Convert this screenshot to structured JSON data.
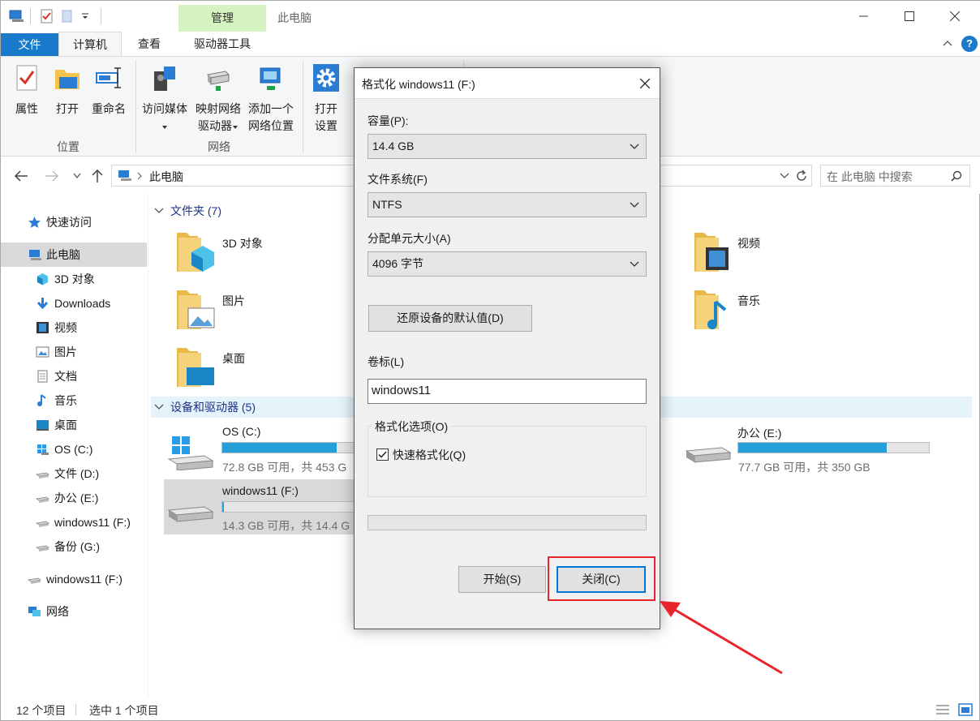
{
  "title_bar": {
    "context_tab": "管理",
    "window_title": "此电脑"
  },
  "tabs": {
    "file": "文件",
    "computer": "计算机",
    "view": "查看",
    "drive_tools": "驱动器工具"
  },
  "ribbon": {
    "location": {
      "label": "位置",
      "properties": "属性",
      "open": "打开",
      "rename": "重命名"
    },
    "network": {
      "label": "网络",
      "media_1": "访问媒体",
      "map_1": "映射网络",
      "map_2": "驱动器",
      "add_1": "添加一个",
      "add_2": "网络位置"
    },
    "system": {
      "settings_1": "打开",
      "settings_2": "设置"
    }
  },
  "address": {
    "path": "此电脑",
    "search_placeholder": "在 此电脑 中搜索"
  },
  "sidebar": {
    "quick_access": "快速访问",
    "this_pc": "此电脑",
    "items": [
      "3D 对象",
      "Downloads",
      "视频",
      "图片",
      "文档",
      "音乐",
      "桌面",
      "OS (C:)",
      "文件 (D:)",
      "办公 (E:)",
      "windows11 (F:)",
      "备份 (G:)"
    ],
    "usb": "windows11 (F:)",
    "network": "网络"
  },
  "main": {
    "folders_header": "文件夹 (7)",
    "folders": {
      "obj3d": "3D 对象",
      "pictures": "图片",
      "desktop": "桌面",
      "videos": "视频",
      "music": "音乐"
    },
    "devices_header": "设备和驱动器 (5)",
    "drives": {
      "c": {
        "name": "OS (C:)",
        "info": "72.8 GB 可用，共 453 G",
        "used": 0.84
      },
      "e": {
        "name": "办公 (E:)",
        "info": "77.7 GB 可用，共 350 GB",
        "used": 0.78
      },
      "f": {
        "name": "windows11 (F:)",
        "info": "14.3 GB 可用，共 14.4 G",
        "used": 0.01
      }
    }
  },
  "status": {
    "count": "12 个项目",
    "selected": "选中 1 个项目"
  },
  "dialog": {
    "title": "格式化 windows11 (F:)",
    "capacity_label": "容量(P):",
    "capacity_value": "14.4 GB",
    "fs_label": "文件系统(F)",
    "fs_value": "NTFS",
    "alloc_label": "分配单元大小(A)",
    "alloc_value": "4096 字节",
    "restore_button": "还原设备的默认值(D)",
    "volume_label": "卷标(L)",
    "volume_value": "windows11",
    "options_label": "格式化选项(O)",
    "quick_format": "快速格式化(Q)",
    "start_button": "开始(S)",
    "close_button": "关闭(C)"
  }
}
